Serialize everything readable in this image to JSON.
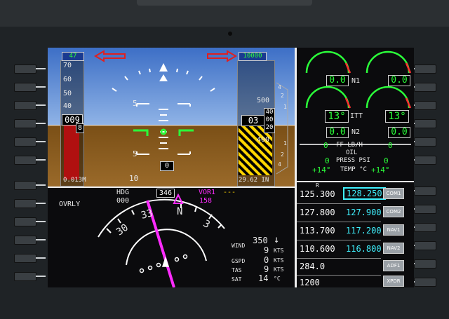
{
  "pfd": {
    "speed_bug": "47",
    "alt_bug": "10000",
    "speed_tape": [
      "70",
      "60",
      "50",
      "40"
    ],
    "airspeed": "009",
    "airspeed_small": "8",
    "alt_tape": [
      "500",
      "400"
    ],
    "altitude": "03",
    "altitude_hi": "40",
    "altitude_lo": "20",
    "vsi_marks": [
      "4",
      "2",
      "1",
      "1",
      "2",
      "4"
    ],
    "pitch_5_top": "5",
    "pitch_5_bottom": "5",
    "pitch_10": "10",
    "baro_min": "0.013M",
    "baro": "29.62 IN",
    "vs_readout": "0"
  },
  "nd": {
    "hdg_label": "HDG",
    "hdg_value": "000",
    "heading": "346",
    "nav_label": "VOR1",
    "nav_dashes": "---",
    "nav_value": "158",
    "ovrly": "OVRLY",
    "compass": [
      "30",
      "33",
      "N",
      "3"
    ],
    "wind_label": "WIND",
    "wind_dir": "350",
    "wind_speed": "9",
    "gspd_label": "GSPD",
    "gspd": "0",
    "tas_label": "TAS",
    "tas": "9",
    "sat_label": "SAT",
    "sat": "14",
    "kts": "KTS",
    "degc": "°C"
  },
  "eng": {
    "n1_left": "0.0",
    "n1_right": "0.0",
    "n1_label": "N1",
    "itt_left": "13°",
    "itt_right": "13°",
    "itt_label": "ITT",
    "n2_left": "0.0",
    "n2_right": "0.0",
    "n2_label": "N2",
    "ff_left": "0",
    "ff_right": "0",
    "ff_label": "FF LB/H",
    "oil_label": "OIL",
    "press_left": "0",
    "press_right": "0",
    "press_label": "PRESS PSI",
    "temp_left": "+14°",
    "temp_right": "+14°",
    "temp_label": "TEMP °C"
  },
  "radio": {
    "r_marker": "R",
    "rows": [
      {
        "active": "125.300",
        "standby": "128.250",
        "btn": "COM1"
      },
      {
        "active": "127.800",
        "standby": "127.900",
        "btn": "COM2"
      },
      {
        "active": "113.700",
        "standby": "117.200",
        "btn": "NAV1"
      },
      {
        "active": "110.600",
        "standby": "116.800",
        "btn": "NAV2"
      },
      {
        "active": "284.0",
        "standby": "",
        "btn": "ADF1"
      },
      {
        "active": "1200",
        "standby": "",
        "btn": "XPDR"
      }
    ]
  },
  "colors": {
    "green": "#2bff3a",
    "magenta": "#ff2bff",
    "cyan": "#3ff2ff",
    "sky": "#4f86d6",
    "ground": "#8a5a1e"
  }
}
